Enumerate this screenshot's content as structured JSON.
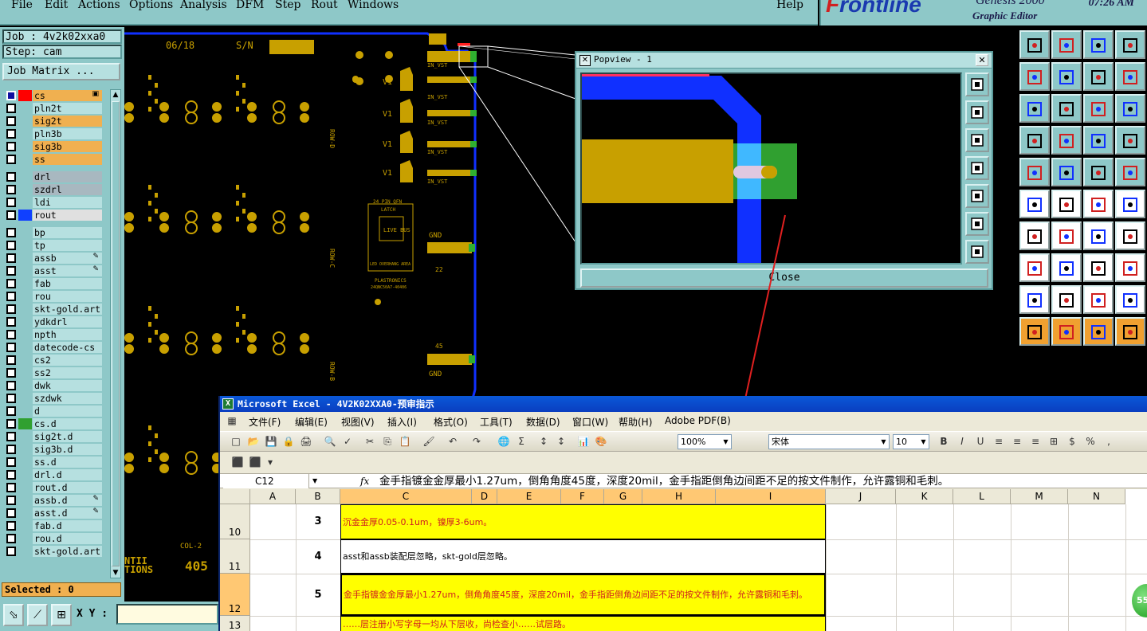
{
  "menubar": {
    "items": [
      "File",
      "Edit",
      "Actions",
      "Options",
      "Analysis",
      "DFM",
      "Step",
      "Rout",
      "Windows"
    ],
    "help": "Help"
  },
  "logo": {
    "brand_f": "F",
    "brand_rest": "rontline",
    "product": "Genesis 2000",
    "subtitle": "Graphic Editor",
    "time": "07:26 AM"
  },
  "left_panel": {
    "job": "Job : 4v2k02xxa0",
    "step": "Step: cam",
    "job_matrix": "Job Matrix ...",
    "selected": "Selected : 0",
    "xy_label": "X Y :",
    "xy_value": ""
  },
  "layers": [
    {
      "name": "cs",
      "color": "#f0b050",
      "swatch": "#ff0000",
      "tag": "▣",
      "active": true
    },
    {
      "name": "pln2t",
      "color": "#b6e0e0",
      "swatch": "#8ec8c8"
    },
    {
      "name": "sig2t",
      "color": "#f0b050",
      "swatch": "#8ec8c8"
    },
    {
      "name": "pln3b",
      "color": "#b6e0e0",
      "swatch": "#8ec8c8"
    },
    {
      "name": "sig3b",
      "color": "#f0b050",
      "swatch": "#8ec8c8"
    },
    {
      "name": "ss",
      "color": "#f0b050",
      "swatch": "#8ec8c8"
    },
    {
      "name": "drl",
      "color": "#a8b8c0",
      "swatch": "#8ec8c8"
    },
    {
      "name": "szdrl",
      "color": "#a8b8c0",
      "swatch": "#8ec8c8"
    },
    {
      "name": "ldi",
      "color": "#b6e0e0",
      "swatch": "#8ec8c8"
    },
    {
      "name": "rout",
      "color": "#e0e0e0",
      "swatch": "#1040ff"
    },
    {
      "name": "bp",
      "color": "#b6e0e0",
      "swatch": "#8ec8c8"
    },
    {
      "name": "tp",
      "color": "#b6e0e0",
      "swatch": "#8ec8c8"
    },
    {
      "name": "assb",
      "color": "#b6e0e0",
      "swatch": "#8ec8c8",
      "tag": "✎"
    },
    {
      "name": "asst",
      "color": "#b6e0e0",
      "swatch": "#8ec8c8",
      "tag": "✎"
    },
    {
      "name": "fab",
      "color": "#b6e0e0",
      "swatch": "#8ec8c8"
    },
    {
      "name": "rou",
      "color": "#b6e0e0",
      "swatch": "#8ec8c8"
    },
    {
      "name": "skt-gold.art",
      "color": "#b6e0e0",
      "swatch": "#8ec8c8"
    },
    {
      "name": "ydkdrl",
      "color": "#b6e0e0",
      "swatch": "#8ec8c8"
    },
    {
      "name": "npth",
      "color": "#b6e0e0",
      "swatch": "#8ec8c8"
    },
    {
      "name": "datecode-cs",
      "color": "#b6e0e0",
      "swatch": "#8ec8c8"
    },
    {
      "name": "cs2",
      "color": "#b6e0e0",
      "swatch": "#8ec8c8"
    },
    {
      "name": "ss2",
      "color": "#b6e0e0",
      "swatch": "#8ec8c8"
    },
    {
      "name": "dwk",
      "color": "#b6e0e0",
      "swatch": "#8ec8c8"
    },
    {
      "name": "szdwk",
      "color": "#b6e0e0",
      "swatch": "#8ec8c8"
    },
    {
      "name": "d",
      "color": "#b6e0e0",
      "swatch": "#8ec8c8"
    },
    {
      "name": "cs.d",
      "color": "#b6e0e0",
      "swatch": "#30a030"
    },
    {
      "name": "sig2t.d",
      "color": "#b6e0e0",
      "swatch": "#8ec8c8"
    },
    {
      "name": "sig3b.d",
      "color": "#b6e0e0",
      "swatch": "#8ec8c8"
    },
    {
      "name": "ss.d",
      "color": "#b6e0e0",
      "swatch": "#8ec8c8"
    },
    {
      "name": "drl.d",
      "color": "#b6e0e0",
      "swatch": "#8ec8c8"
    },
    {
      "name": "rout.d",
      "color": "#b6e0e0",
      "swatch": "#8ec8c8"
    },
    {
      "name": "assb.d",
      "color": "#b6e0e0",
      "swatch": "#8ec8c8",
      "tag": "✎"
    },
    {
      "name": "asst.d",
      "color": "#b6e0e0",
      "swatch": "#8ec8c8",
      "tag": "✎"
    },
    {
      "name": "fab.d",
      "color": "#b6e0e0",
      "swatch": "#8ec8c8"
    },
    {
      "name": "rou.d",
      "color": "#b6e0e0",
      "swatch": "#8ec8c8"
    },
    {
      "name": "skt-gold.art",
      "color": "#b6e0e0",
      "swatch": "#8ec8c8"
    }
  ],
  "pcb_labels": {
    "date": "06/18",
    "sn": "S/N",
    "v1": "V1",
    "in_vst": "IN_VST",
    "gnd": "GND",
    "n22": "22",
    "n45": "45",
    "pin_title": "24 PIN QFN",
    "latch": "LATCH",
    "live_bus": "LIVE BUS",
    "led": "LED OVERHANG AREA",
    "plastronics": "PLASTRONICS",
    "part": "24QNC50A7-40406",
    "col": "COL-2",
    "brand_frag": "NTI\nTIONS",
    "num_frag": "405",
    "row_d": "ROW-D",
    "row_c": "ROW-C",
    "row_b": "ROW-B"
  },
  "popview": {
    "title": "Popview - 1",
    "close": "Close"
  },
  "excel": {
    "title": "Microsoft Excel - 4V2K02XXA0-预审指示",
    "menus": [
      "文件(F)",
      "编辑(E)",
      "视图(V)",
      "插入(I)",
      "格式(O)",
      "工具(T)",
      "数据(D)",
      "窗口(W)",
      "帮助(H)",
      "Adobe PDF(B)"
    ],
    "zoom": "100%",
    "font": "宋体",
    "size": "10",
    "namebox": "C12",
    "fx": "fx",
    "formula": "金手指镀金金厚最小1.27um，倒角角度45度，深度20mil，金手指距倒角边间距不足的按文件制作，允许露铜和毛刺。",
    "columns": [
      "A",
      "B",
      "C",
      "D",
      "E",
      "F",
      "G",
      "H",
      "I",
      "J",
      "K",
      "L",
      "M",
      "N"
    ],
    "rows": [
      {
        "row": "10",
        "num": "3",
        "text": "沉金金厚0.05-0.1um，镍厚3-6um。",
        "highlight": true
      },
      {
        "row": "11",
        "num": "4",
        "text": "asst和assb装配层忽略，skt-gold层忽略。",
        "highlight": false
      },
      {
        "row": "12",
        "num": "5",
        "text": "金手指镀金金厚最小1.27um，倒角角度45度，深度20mil，金手指距倒角边间距不足的按文件制作，允许露铜和毛刺。",
        "highlight": true
      },
      {
        "row": "13",
        "num": "",
        "text": "……层注册小写字母一均从下层收，尚检查小……试层路。",
        "highlight": true
      }
    ]
  },
  "badge": "55"
}
